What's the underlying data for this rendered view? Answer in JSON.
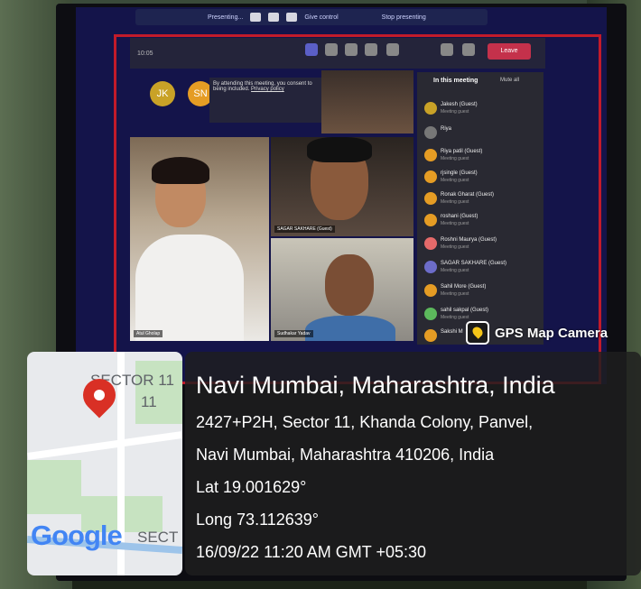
{
  "meeting": {
    "top_bar": {
      "presenting": "Presenting...",
      "stop": "Stop presenting",
      "control": "Give control"
    },
    "clock": "10:05",
    "leave_label": "Leave",
    "notice": {
      "text": "By attending this meeting, you consent to being included.",
      "link": "Privacy policy"
    },
    "avatars": [
      {
        "initials": "JK",
        "color": "#c9a227"
      },
      {
        "initials": "SN",
        "color": "#e59c24"
      }
    ],
    "tiles": [
      {
        "name": "Atul Gholap"
      },
      {
        "name": "SAGAR SAKHARE (Guest)"
      },
      {
        "name": "Sudhakar Yadav"
      }
    ],
    "participants_panel": {
      "title": "In this meeting",
      "mute_all": "Mute all",
      "people": [
        {
          "name": "Jakesh (Guest)",
          "sub": "Meeting guest",
          "color": "#c9a227"
        },
        {
          "name": "Riya",
          "sub": "",
          "color": "#777"
        },
        {
          "name": "Riya patil (Guest)",
          "sub": "Meeting guest",
          "color": "#e59c24"
        },
        {
          "name": "rjsingle (Guest)",
          "sub": "Meeting guest",
          "color": "#e59c24"
        },
        {
          "name": "Ronak Gharat (Guest)",
          "sub": "Meeting guest",
          "color": "#e59c24"
        },
        {
          "name": "roshani (Guest)",
          "sub": "Meeting guest",
          "color": "#e59c24"
        },
        {
          "name": "Roshni Maurya (Guest)",
          "sub": "Meeting guest",
          "color": "#e56a6a"
        },
        {
          "name": "SAGAR SAKHARE (Guest)",
          "sub": "Meeting guest",
          "color": "#6c6cc9"
        },
        {
          "name": "Sahil More (Guest)",
          "sub": "Meeting guest",
          "color": "#e59c24"
        },
        {
          "name": "sahil sakpal (Guest)",
          "sub": "Meeting guest",
          "color": "#5cb85c"
        },
        {
          "name": "Sakshi M",
          "sub": "",
          "color": "#e59c24"
        }
      ]
    }
  },
  "watermark": {
    "app_name": "GPS Map Camera"
  },
  "map": {
    "sector_label_1": "SECTOR 11",
    "sector_label_2": "11",
    "sector_label_3": "SECT",
    "google_logo": "Google"
  },
  "location": {
    "title": "Navi Mumbai, Maharashtra, India",
    "address_line_1": "2427+P2H, Sector 11, Khanda Colony, Panvel,",
    "address_line_2": "Navi Mumbai, Maharashtra 410206, India",
    "lat": "Lat 19.001629°",
    "long": "Long 73.112639°",
    "timestamp": "16/09/22 11:20 AM GMT +05:30"
  }
}
